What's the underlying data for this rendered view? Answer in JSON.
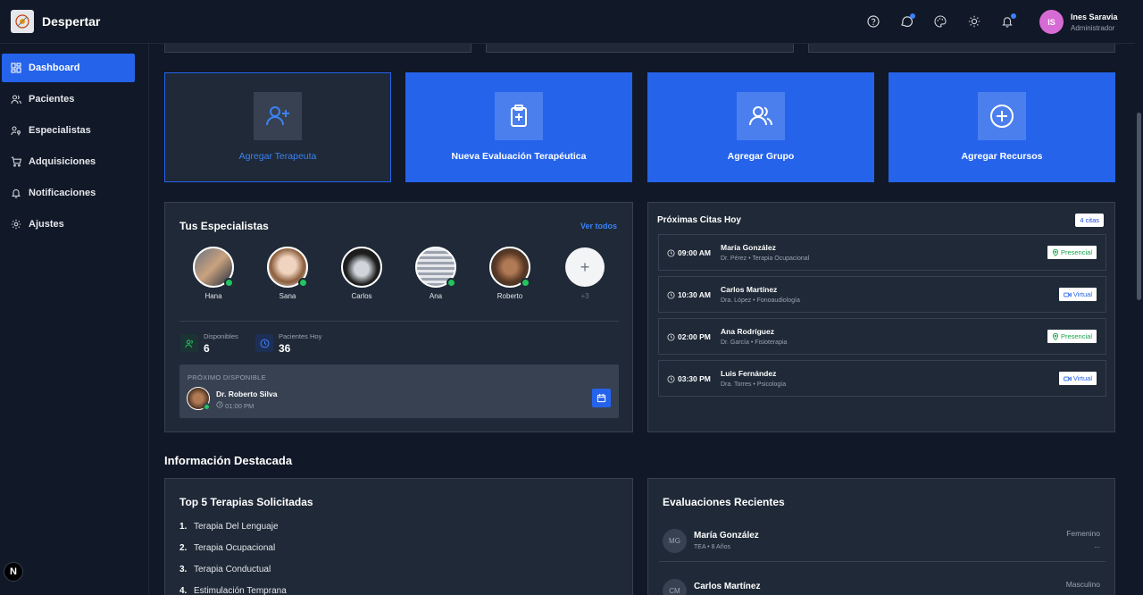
{
  "app": {
    "title": "Despertar"
  },
  "user": {
    "initials": "IS",
    "name": "Ines Saravia",
    "role": "Administrador"
  },
  "sidebar": {
    "items": [
      {
        "label": "Dashboard",
        "icon": "dashboard-icon",
        "active": true
      },
      {
        "label": "Pacientes",
        "icon": "users-icon"
      },
      {
        "label": "Especialistas",
        "icon": "user-key-icon"
      },
      {
        "label": "Adquisiciones",
        "icon": "cart-icon"
      },
      {
        "label": "Notificaciones",
        "icon": "bell-icon"
      },
      {
        "label": "Ajustes",
        "icon": "gear-icon"
      }
    ]
  },
  "actions": [
    {
      "label": "Agregar Terapeuta",
      "icon": "user-plus-icon"
    },
    {
      "label": "Nueva Evaluación Terapéutica",
      "icon": "clipboard-plus-icon"
    },
    {
      "label": "Agregar Grupo",
      "icon": "users-group-icon"
    },
    {
      "label": "Agregar Recursos",
      "icon": "plus-circle-icon"
    }
  ],
  "specialists": {
    "title": "Tus Especialistas",
    "view_all": "Ver todos",
    "people": [
      {
        "name": "Hana",
        "online": true
      },
      {
        "name": "Sana",
        "online": true
      },
      {
        "name": "Carlos",
        "online": false
      },
      {
        "name": "Ana",
        "online": true
      },
      {
        "name": "Roberto",
        "online": true
      }
    ],
    "add_label": "+3",
    "stats": {
      "available_label": "Disponibles",
      "available_value": "6",
      "patients_label": "Pacientes Hoy",
      "patients_value": "36"
    },
    "next": {
      "label": "PRÓXIMO DISPONIBLE",
      "name": "Dr. Roberto Silva",
      "time": "01:00 PM"
    }
  },
  "appointments": {
    "title": "Próximas Citas Hoy",
    "count": "4 citas",
    "items": [
      {
        "time": "09:00 AM",
        "patient": "María González",
        "detail": "Dr. Pérez • Terapia Ocupacional",
        "mode": "Presencial"
      },
      {
        "time": "10:30 AM",
        "patient": "Carlos Martínez",
        "detail": "Dra. López • Fonoaudiología",
        "mode": "Virtual"
      },
      {
        "time": "02:00 PM",
        "patient": "Ana Rodríguez",
        "detail": "Dr. García • Fisioterapia",
        "mode": "Presencial"
      },
      {
        "time": "03:30 PM",
        "patient": "Luis Fernández",
        "detail": "Dra. Torres • Psicología",
        "mode": "Virtual"
      }
    ]
  },
  "featured": {
    "title": "Información Destacada"
  },
  "top_therapies": {
    "title": "Top 5 Terapias Solicitadas",
    "items": [
      {
        "num": "1.",
        "label": "Terapia Del Lenguaje"
      },
      {
        "num": "2.",
        "label": "Terapia Ocupacional"
      },
      {
        "num": "3.",
        "label": "Terapia Conductual"
      },
      {
        "num": "4.",
        "label": "Estimulación Temprana"
      }
    ]
  },
  "evaluations": {
    "title": "Evaluaciones Recientes",
    "items": [
      {
        "initials": "MG",
        "name": "María González",
        "sub": "TEA • 8 Años",
        "gender": "Femenino",
        "extra": "..."
      },
      {
        "initials": "CM",
        "name": "Carlos Martínez",
        "sub": "",
        "gender": "Masculino",
        "extra": ""
      }
    ]
  },
  "colors": {
    "accent": "#2563eb",
    "background": "#111827",
    "panel": "#1f2937",
    "online": "#22c55e",
    "presencial": "#16a34a",
    "virtual": "#2563eb"
  },
  "footer_badge": "N"
}
